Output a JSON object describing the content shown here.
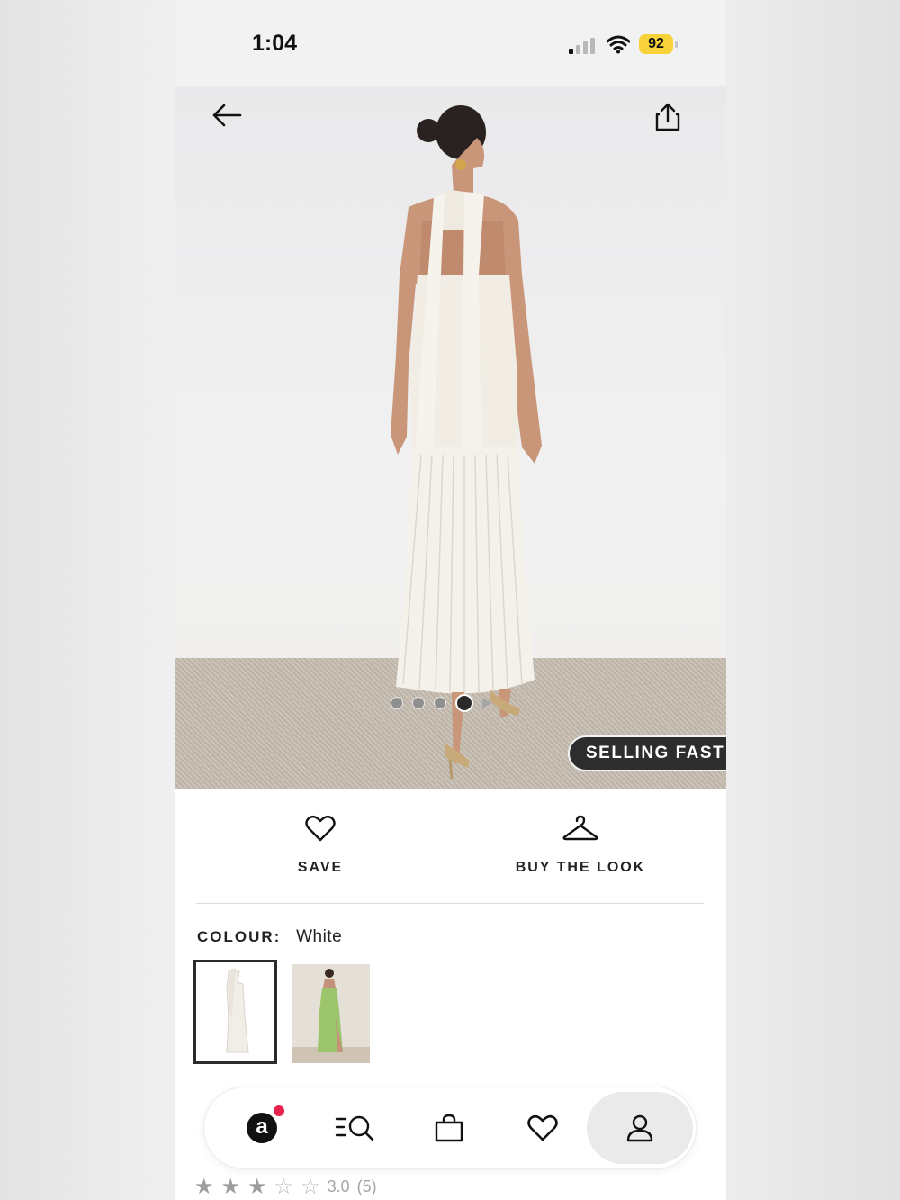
{
  "status_bar": {
    "time": "1:04",
    "battery": "92"
  },
  "product_gallery": {
    "image_alt": "Model wearing white halter dress with pleated skirt",
    "dots_total": 4,
    "dots_active_index": 3,
    "badge": "SELLING FAST"
  },
  "actions": {
    "save_label": "SAVE",
    "buy_the_look_label": "BUY THE LOOK"
  },
  "colour": {
    "label": "COLOUR:",
    "value": "White",
    "swatches": [
      "White",
      "Green"
    ]
  },
  "rating": {
    "value": "3.0",
    "count": "(5)",
    "stars_filled": 3,
    "stars_total": 5
  },
  "nav": {
    "items": [
      "home-icon",
      "search-icon",
      "bag-icon",
      "heart-icon",
      "account-icon"
    ],
    "active": "account",
    "colors": {
      "notification": "#e8214f",
      "badge": "#2d2d2d",
      "battery": "#f7d23b"
    }
  }
}
